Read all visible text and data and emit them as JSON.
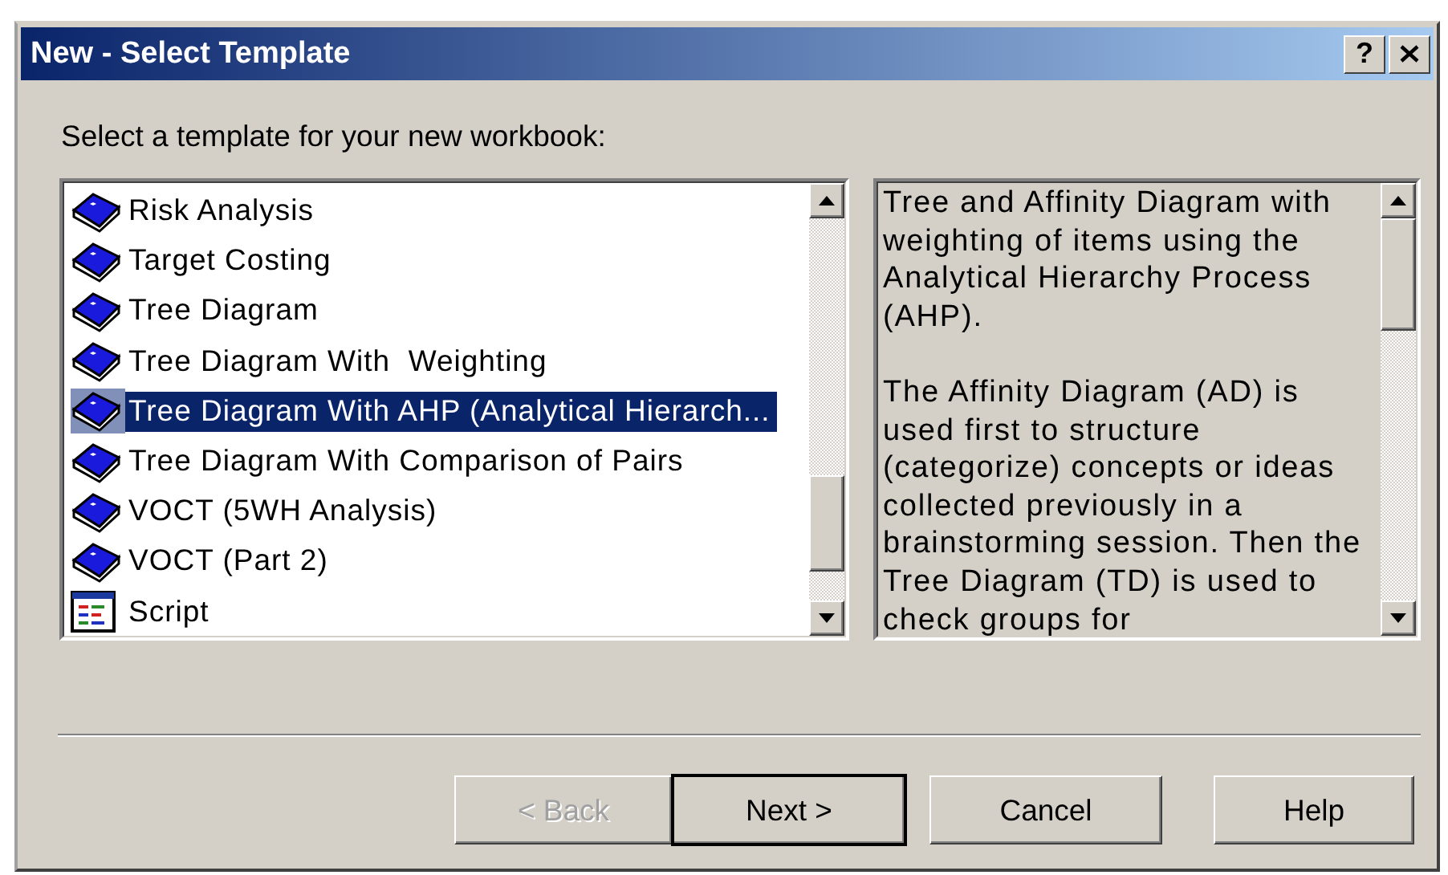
{
  "window": {
    "title": "New - Select Template",
    "help_button": "?"
  },
  "prompt": "Select a template for your new workbook:",
  "templates": [
    {
      "label": "Risk Analysis",
      "kind": "book",
      "selected": false
    },
    {
      "label": "Target Costing",
      "kind": "book",
      "selected": false
    },
    {
      "label": "Tree Diagram",
      "kind": "book",
      "selected": false
    },
    {
      "label": "Tree Diagram With  Weighting",
      "kind": "book",
      "selected": false
    },
    {
      "label": "Tree Diagram With AHP (Analytical Hierarch...",
      "kind": "book",
      "selected": true
    },
    {
      "label": "Tree Diagram With Comparison of Pairs",
      "kind": "book",
      "selected": false
    },
    {
      "label": "VOCT (5WH Analysis)",
      "kind": "book",
      "selected": false
    },
    {
      "label": "VOCT (Part 2)",
      "kind": "book",
      "selected": false
    },
    {
      "label": "Script",
      "kind": "script",
      "selected": false
    }
  ],
  "description": [
    "Tree and Affinity Diagram with weighting of items using the Analytical Hierarchy Process (AHP).",
    "The Affinity Diagram (AD) is used first to structure (categorize) concepts or ideas collected previously in a brainstorming session. Then the Tree Diagram (TD) is used to check groups for"
  ],
  "buttons": [
    {
      "label": "< Back",
      "disabled": true,
      "default": false
    },
    {
      "label": "Next >",
      "disabled": false,
      "default": true
    },
    {
      "label": "Cancel",
      "disabled": false,
      "default": false
    },
    {
      "label": "Help",
      "disabled": false,
      "default": false
    }
  ]
}
